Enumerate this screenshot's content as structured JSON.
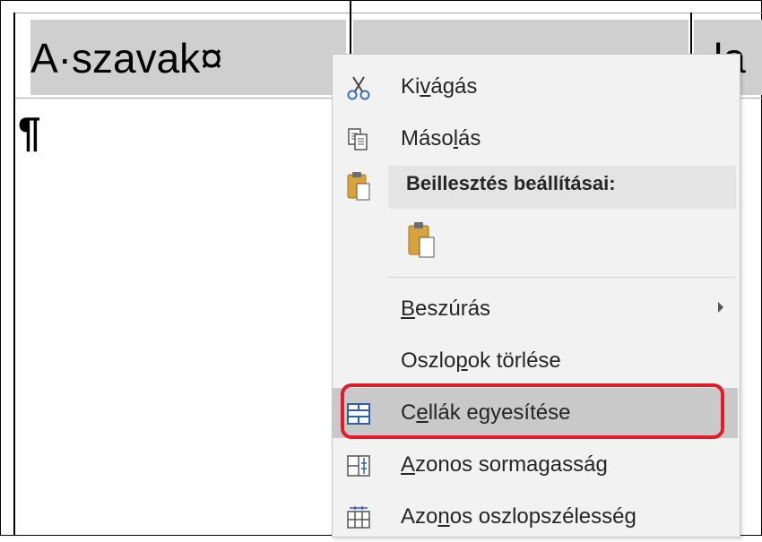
{
  "document": {
    "cell_1_text": "A·szavak¤",
    "cell_2_text": "…",
    "cell_3_text": "la",
    "paragraph_mark": "¶"
  },
  "context_menu": {
    "cut": {
      "label": "Kivágás",
      "icon": "scissors-icon"
    },
    "copy": {
      "label": "Másolás",
      "icon": "copy-icon"
    },
    "paste_header": {
      "label": "Beillesztés beállításai:",
      "icon": "paste-icon"
    },
    "paste_option": {
      "icon": "paste-keep-formatting-icon"
    },
    "insert": {
      "label": "Beszúrás",
      "has_submenu": true
    },
    "delete_columns": {
      "label": "Oszlopok törlése"
    },
    "merge_cells": {
      "label": "Cellák egyesítése",
      "icon": "merge-cells-icon",
      "highlighted": true
    },
    "distribute_rows": {
      "label": "Azonos sormagasság",
      "icon": "distribute-rows-icon"
    },
    "distribute_columns": {
      "label": "Azonos oszlopszélesség",
      "icon": "distribute-columns-icon"
    }
  },
  "colors": {
    "menu_bg": "#f2f2f2",
    "hover_bg": "#c9c9c9",
    "annotation_red": "#e31b2b",
    "selection_gray": "#cfcfcf"
  }
}
